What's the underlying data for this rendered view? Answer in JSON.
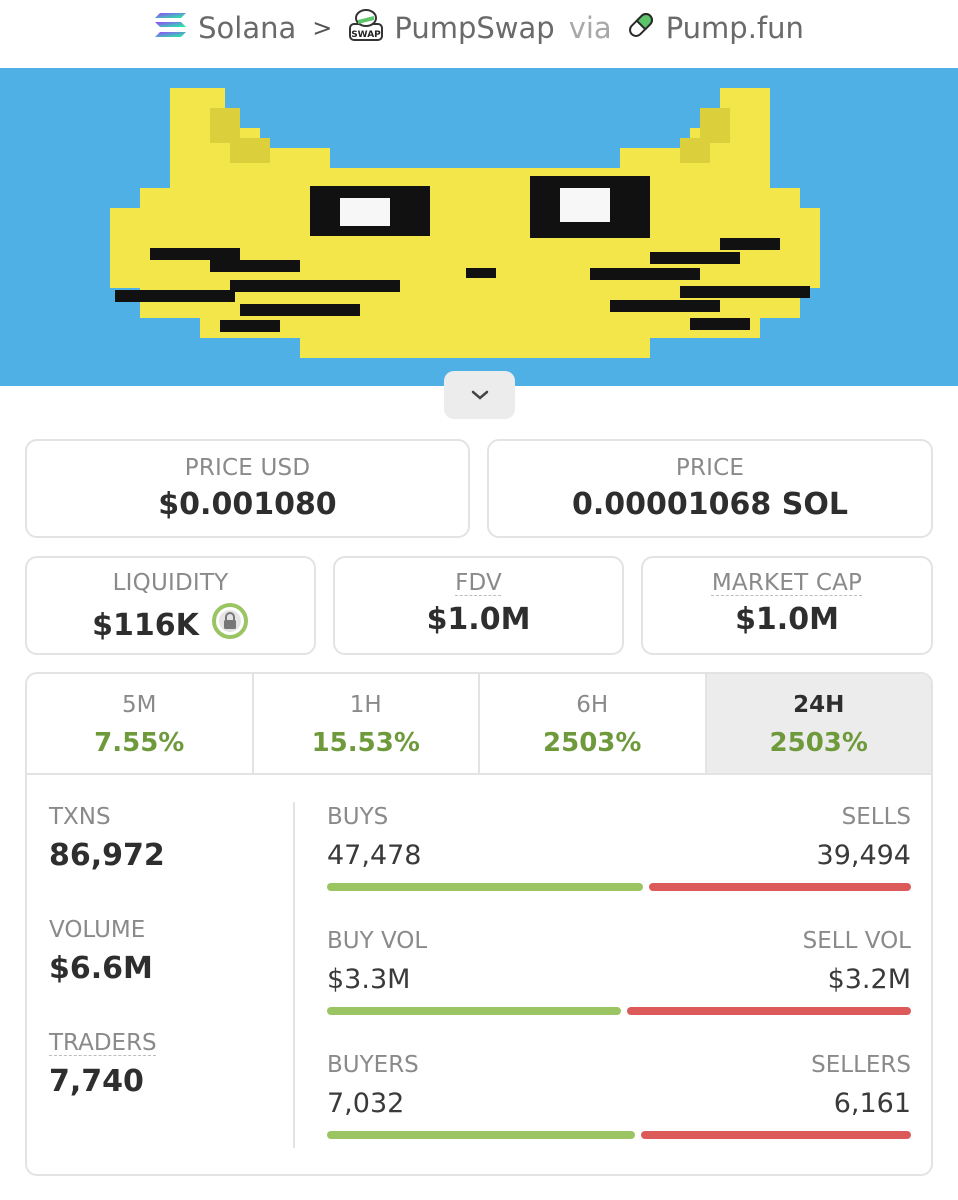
{
  "breadcrumb": {
    "chain": "Solana",
    "dex": "PumpSwap",
    "via": "via",
    "launchpad": "Pump.fun",
    "dex_badge": "SWAP"
  },
  "prices": {
    "price_usd_label": "PRICE USD",
    "price_usd": "$0.001080",
    "price_label": "PRICE",
    "price_native": "0.00001068 SOL"
  },
  "metrics": {
    "liquidity_label": "LIQUIDITY",
    "liquidity": "$116K",
    "fdv_label": "FDV",
    "fdv": "$1.0M",
    "mcap_label": "MARKET CAP",
    "mcap": "$1.0M"
  },
  "tabs": [
    {
      "label": "5M",
      "change": "7.55%"
    },
    {
      "label": "1H",
      "change": "15.53%"
    },
    {
      "label": "6H",
      "change": "2503%"
    },
    {
      "label": "24H",
      "change": "2503%"
    }
  ],
  "active_tab": "24H",
  "stats": {
    "txns_label": "TXNS",
    "txns": "86,972",
    "volume_label": "VOLUME",
    "volume": "$6.6M",
    "traders_label": "TRADERS",
    "traders": "7,740"
  },
  "splits": [
    {
      "left_label": "BUYS",
      "right_label": "SELLS",
      "left_value": "47,478",
      "right_value": "39,494",
      "left_share": 0.546
    },
    {
      "left_label": "BUY VOL",
      "right_label": "SELL VOL",
      "left_value": "$3.3M",
      "right_value": "$3.2M",
      "left_share": 0.508
    },
    {
      "left_label": "BUYERS",
      "right_label": "SELLERS",
      "left_value": "7,032",
      "right_value": "6,161",
      "left_share": 0.533
    }
  ],
  "colors": {
    "positive": "#6e9a3c",
    "buy_bar": "#9bc463",
    "sell_bar": "#dc5a5a",
    "banner_bg": "#4fb0e6",
    "cat_yellow": "#f3e64a"
  },
  "icons": {
    "chain": "solana-icon",
    "dex": "pumpswap-icon",
    "launchpad": "pill-icon",
    "lock": "lock-icon",
    "expand": "chevron-down-icon"
  }
}
